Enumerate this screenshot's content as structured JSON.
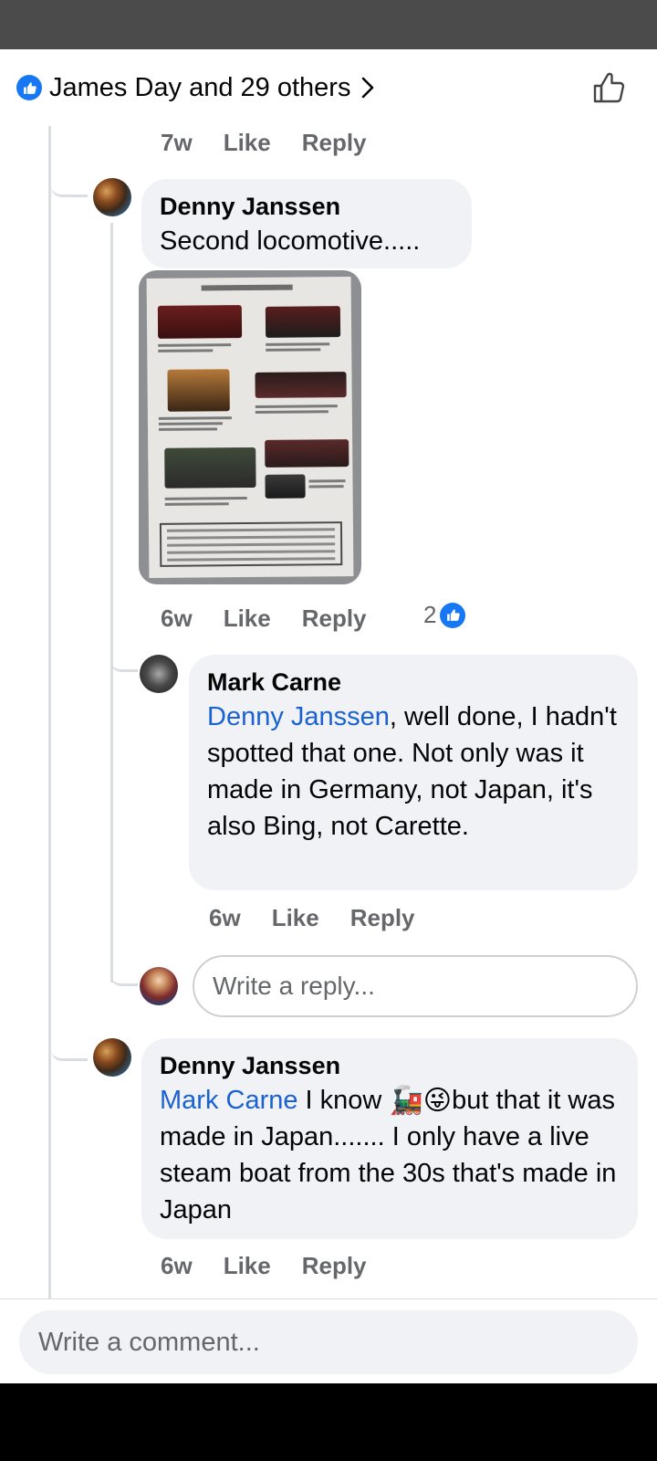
{
  "header": {
    "reactions_summary": "James Day and 29 others"
  },
  "top_meta": {
    "time": "7w",
    "like": "Like",
    "reply": "Reply"
  },
  "comments": [
    {
      "author": "Denny Janssen",
      "text": "Second locomotive.....",
      "meta": {
        "time": "6w",
        "like": "Like",
        "reply": "Reply"
      },
      "reaction_count": "2"
    },
    {
      "author": "Mark Carne",
      "mention": "Denny Janssen",
      "text": ", well done, I hadn't spotted that one. Not only was it made in Germany, not Japan, it's also Bing, not Carette.",
      "meta": {
        "time": "6w",
        "like": "Like",
        "reply": "Reply"
      }
    },
    {
      "author": "Denny Janssen",
      "mention": "Mark Carne",
      "text_before": " I know ",
      "emojis": "🚂😜",
      "text_after": "but that it was made in Japan.......  I only have a live steam boat from the 30s that's made in Japan",
      "meta": {
        "time": "6w",
        "like": "Like",
        "reply": "Reply"
      }
    }
  ],
  "reply_box": {
    "placeholder": "Write a reply..."
  },
  "comment_box": {
    "placeholder": "Write a comment..."
  },
  "colors": {
    "accent": "#1877f2",
    "mention": "#1a62d1",
    "bubble": "#f0f2f5",
    "meta_text": "#65676b"
  },
  "icons": {
    "reaction": "like-icon",
    "chevron": "chevron-right-icon",
    "like_button": "thumbs-up-outline-icon"
  }
}
